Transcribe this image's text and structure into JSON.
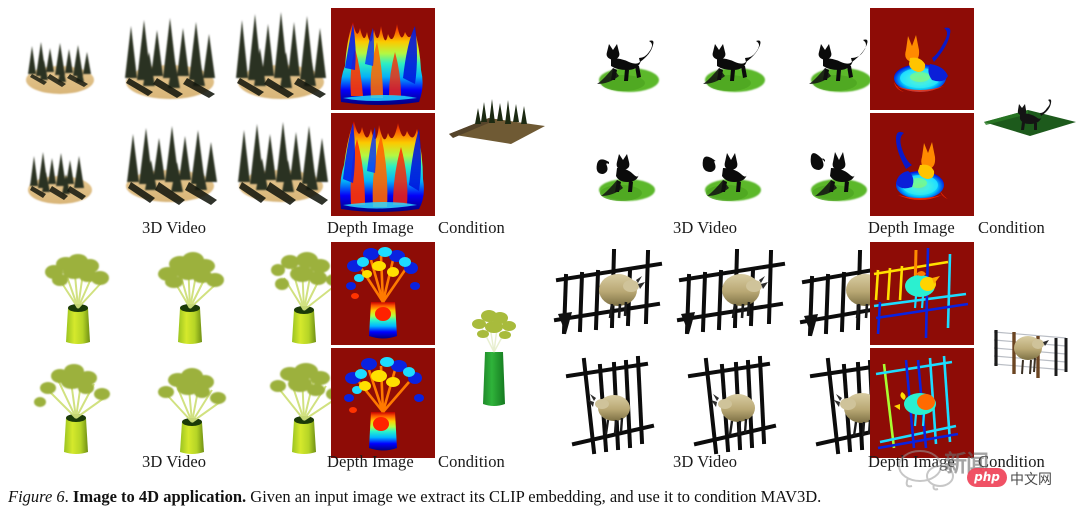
{
  "figure": {
    "number": "Figure 6",
    "caption_lead": "Figure 6",
    "caption_bold": "Image to 4D application.",
    "caption_rest": "Given an input image we extract its CLIP embedding, and use it to condition MAV3D.",
    "background": "#ffffff",
    "depth_panel_background": "#8e0c06"
  },
  "labels": {
    "video_left_top": "3D Video",
    "depth_left_top": "Depth Image",
    "condition_left_top": "Condition",
    "video_right_top": "3D Video",
    "depth_right_top": "Depth Image",
    "condition_right_top": "Condition",
    "video_left_bottom": "3D Video",
    "depth_left_bottom": "Depth Image",
    "condition_left_bottom": "Condition",
    "video_right_bottom": "3D Video",
    "depth_right_bottom": "Depth Image",
    "condition_right_bottom": "Condition"
  },
  "quadrants": [
    {
      "id": "forest",
      "subject": "pine-forest-on-sand-dune",
      "video_frames": 6,
      "depth_frames": 2,
      "condition": "pine-trees-on-brown-terrain"
    },
    {
      "id": "cat",
      "subject": "black-cat-on-grass-patch",
      "video_frames": 6,
      "depth_frames": 2,
      "condition": "black-cat-on-green-lawn"
    },
    {
      "id": "vase",
      "subject": "green-plant-in-yellow-green-vase",
      "video_frames": 6,
      "depth_frames": 2,
      "condition": "plant-in-green-vase"
    },
    {
      "id": "fence",
      "subject": "sheep-behind-black-fence",
      "video_frames": 6,
      "depth_frames": 2,
      "condition": "sheep-behind-wire-fence"
    }
  ],
  "watermark": {
    "brand": "php",
    "chinese": "中文网",
    "site": "新闻"
  }
}
